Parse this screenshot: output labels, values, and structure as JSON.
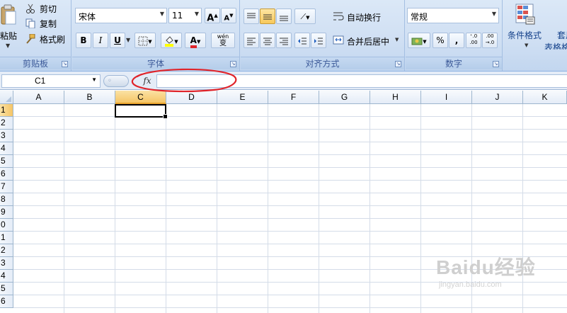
{
  "ribbon": {
    "clipboard": {
      "paste_label": "粘贴",
      "cut_label": "剪切",
      "copy_label": "复制",
      "format_painter_label": "格式刷",
      "group_label": "剪贴板"
    },
    "font": {
      "font_name": "宋体",
      "font_size": "11",
      "increase_size": "A",
      "decrease_size": "A",
      "bold": "B",
      "italic": "I",
      "underline": "U",
      "phonetic": "wén",
      "group_label": "字体"
    },
    "alignment": {
      "wrap_text_label": "自动换行",
      "merge_center_label": "合并后居中",
      "group_label": "对齐方式"
    },
    "number": {
      "format_value": "常规",
      "percent": "%",
      "comma": ",",
      "increase_decimal": "⁺.0 .00",
      "decrease_decimal": ".00 →.0",
      "group_label": "数字"
    },
    "styles": {
      "conditional_format_label": "条件格式",
      "table_format_label_top": "套用",
      "table_format_label_bottom": "表格格式"
    }
  },
  "formula_bar": {
    "name_box": "C1",
    "fx": "fx",
    "formula": ""
  },
  "grid": {
    "columns": [
      "A",
      "B",
      "C",
      "D",
      "E",
      "F",
      "G",
      "H",
      "I",
      "J",
      "K"
    ],
    "rows": [
      "1",
      "2",
      "3",
      "4",
      "5",
      "6",
      "7",
      "8",
      "9",
      "0",
      "1",
      "2",
      "3",
      "4",
      "5",
      "6"
    ],
    "selected_column": "C",
    "selected_row": "1",
    "active_cell": "C1"
  },
  "watermark": {
    "main": "Baidu经验",
    "sub": "jingyan.baidu.com"
  },
  "colors": {
    "ribbon_bg": "#cfdff3",
    "header_select": "#f5c566",
    "annotation": "#e0242a"
  }
}
